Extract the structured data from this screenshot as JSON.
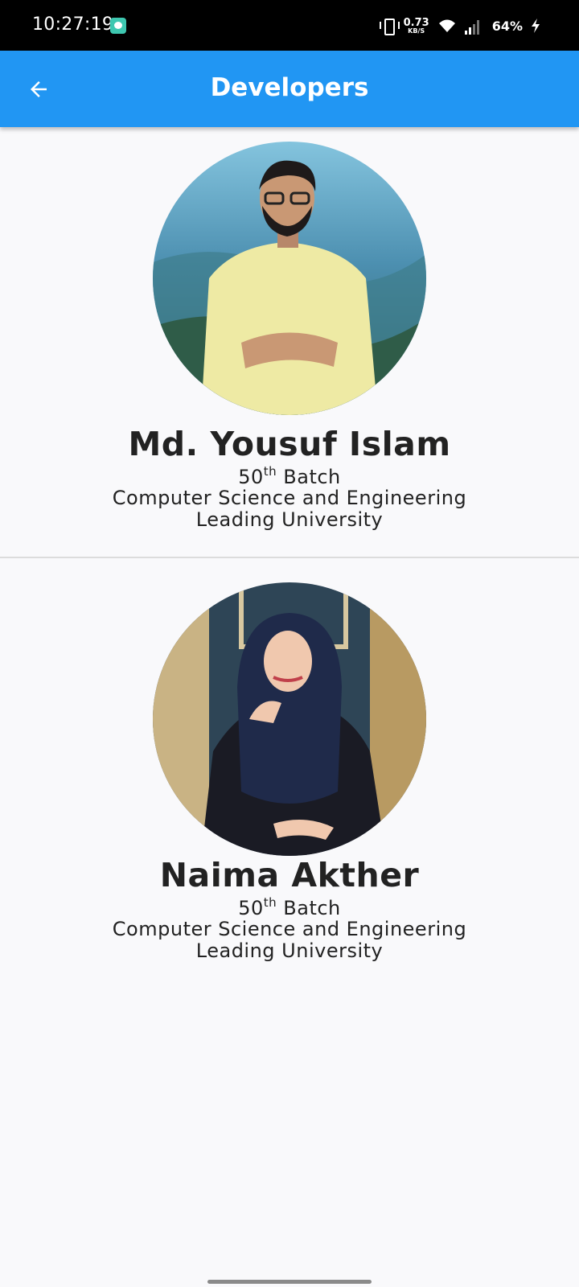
{
  "status_bar": {
    "time": "10:27:19",
    "speed_value": "0.73",
    "speed_unit": "KB/S",
    "battery": "64%"
  },
  "app_bar": {
    "title": "Developers",
    "back_icon": "arrow-back-icon"
  },
  "developers": [
    {
      "name": "Md. Yousuf Islam",
      "batch_number": "50",
      "batch_suffix": "th",
      "batch_word": "Batch",
      "department": "Computer Science and Engineering",
      "university": "Leading University"
    },
    {
      "name": "Naima Akther",
      "batch_number": "50",
      "batch_suffix": "th",
      "batch_word": "Batch",
      "department": "Computer Science and Engineering",
      "university": "Leading University"
    }
  ],
  "colors": {
    "app_bar": "#2196f3",
    "background": "#f9f9fb",
    "text": "#222222"
  }
}
